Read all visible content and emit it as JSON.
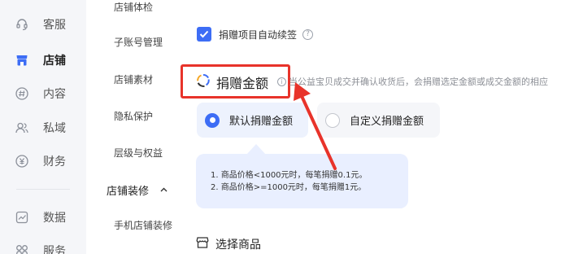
{
  "rail": {
    "items": [
      {
        "label": "客服",
        "icon": "headset-icon"
      },
      {
        "label": "店铺",
        "icon": "shop-icon"
      },
      {
        "label": "内容",
        "icon": "hash-icon"
      },
      {
        "label": "私域",
        "icon": "users-icon"
      },
      {
        "label": "财务",
        "icon": "yen-icon"
      },
      {
        "label": "数据",
        "icon": "chart-icon"
      },
      {
        "label": "服务",
        "icon": "grid-icon"
      }
    ],
    "active": "店铺"
  },
  "subnav": {
    "items": [
      "店铺体检",
      "子账号管理",
      "店铺素材",
      "隐私保护",
      "层级与权益"
    ],
    "group": {
      "label": "店铺装修",
      "caret": "^"
    },
    "group_items": [
      "手机店铺装修"
    ]
  },
  "main": {
    "auto_sign": {
      "label": "捐赠项目自动续签",
      "checked": true,
      "help": "?"
    },
    "donation": {
      "title": "捐赠金额",
      "info_icon": "i",
      "note": "当公益宝贝成交并确认收货后，会捐赠选定金额或成交金额的相应",
      "options": [
        {
          "label": "默认捐赠金额",
          "selected": true
        },
        {
          "label": "自定义捐赠金额",
          "selected": false
        }
      ],
      "tips": [
        "1. 商品价格<1000元时，每笔捐赠0.1元。",
        "2. 商品价格>=1000元时，每笔捐赠1元。"
      ]
    },
    "select_goods": {
      "title": "选择商品"
    }
  },
  "colors": {
    "accent": "#3d6df5",
    "highlight": "#e8332a",
    "rail_bg": "#f5f6f9",
    "tip_bg": "#e9efff"
  }
}
